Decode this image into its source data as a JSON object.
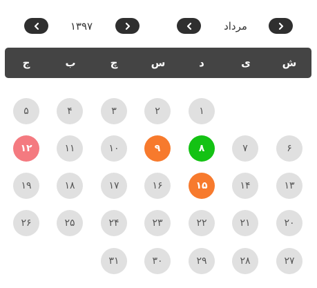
{
  "header": {
    "year": "۱۳۹۷",
    "month": "مرداد",
    "prev_year_icon": "chevron-left-icon",
    "next_year_icon": "chevron-right-icon",
    "prev_month_icon": "chevron-left-icon",
    "next_month_icon": "chevron-right-icon"
  },
  "weekdays": [
    "ش",
    "ی",
    "د",
    "س",
    "چ",
    "ب",
    "ج"
  ],
  "days": [
    {
      "label": "۱",
      "status": "normal"
    },
    {
      "label": "۲",
      "status": "normal"
    },
    {
      "label": "۳",
      "status": "normal"
    },
    {
      "label": "۴",
      "status": "normal"
    },
    {
      "label": "۵",
      "status": "normal"
    },
    {
      "label": "۶",
      "status": "normal"
    },
    {
      "label": "۷",
      "status": "normal"
    },
    {
      "label": "۸",
      "status": "today"
    },
    {
      "label": "۹",
      "status": "highlight"
    },
    {
      "label": "۱۰",
      "status": "normal"
    },
    {
      "label": "۱۱",
      "status": "normal"
    },
    {
      "label": "۱۲",
      "status": "holiday"
    },
    {
      "label": "۱۳",
      "status": "normal"
    },
    {
      "label": "۱۴",
      "status": "normal"
    },
    {
      "label": "۱۵",
      "status": "highlight"
    },
    {
      "label": "۱۶",
      "status": "normal"
    },
    {
      "label": "۱۷",
      "status": "normal"
    },
    {
      "label": "۱۸",
      "status": "normal"
    },
    {
      "label": "۱۹",
      "status": "normal"
    },
    {
      "label": "۲۰",
      "status": "normal"
    },
    {
      "label": "۲۱",
      "status": "normal"
    },
    {
      "label": "۲۲",
      "status": "normal"
    },
    {
      "label": "۲۳",
      "status": "normal"
    },
    {
      "label": "۲۴",
      "status": "normal"
    },
    {
      "label": "۲۵",
      "status": "normal"
    },
    {
      "label": "۲۶",
      "status": "normal"
    },
    {
      "label": "۲۷",
      "status": "normal"
    },
    {
      "label": "۲۸",
      "status": "normal"
    },
    {
      "label": "۲۹",
      "status": "normal"
    },
    {
      "label": "۳۰",
      "status": "normal"
    },
    {
      "label": "۳۱",
      "status": "normal"
    }
  ],
  "colors": {
    "bar": "#444444",
    "today": "#14c214",
    "highlight": "#f77a2d",
    "holiday": "#f47a80",
    "normal": "#e0e0e0"
  }
}
